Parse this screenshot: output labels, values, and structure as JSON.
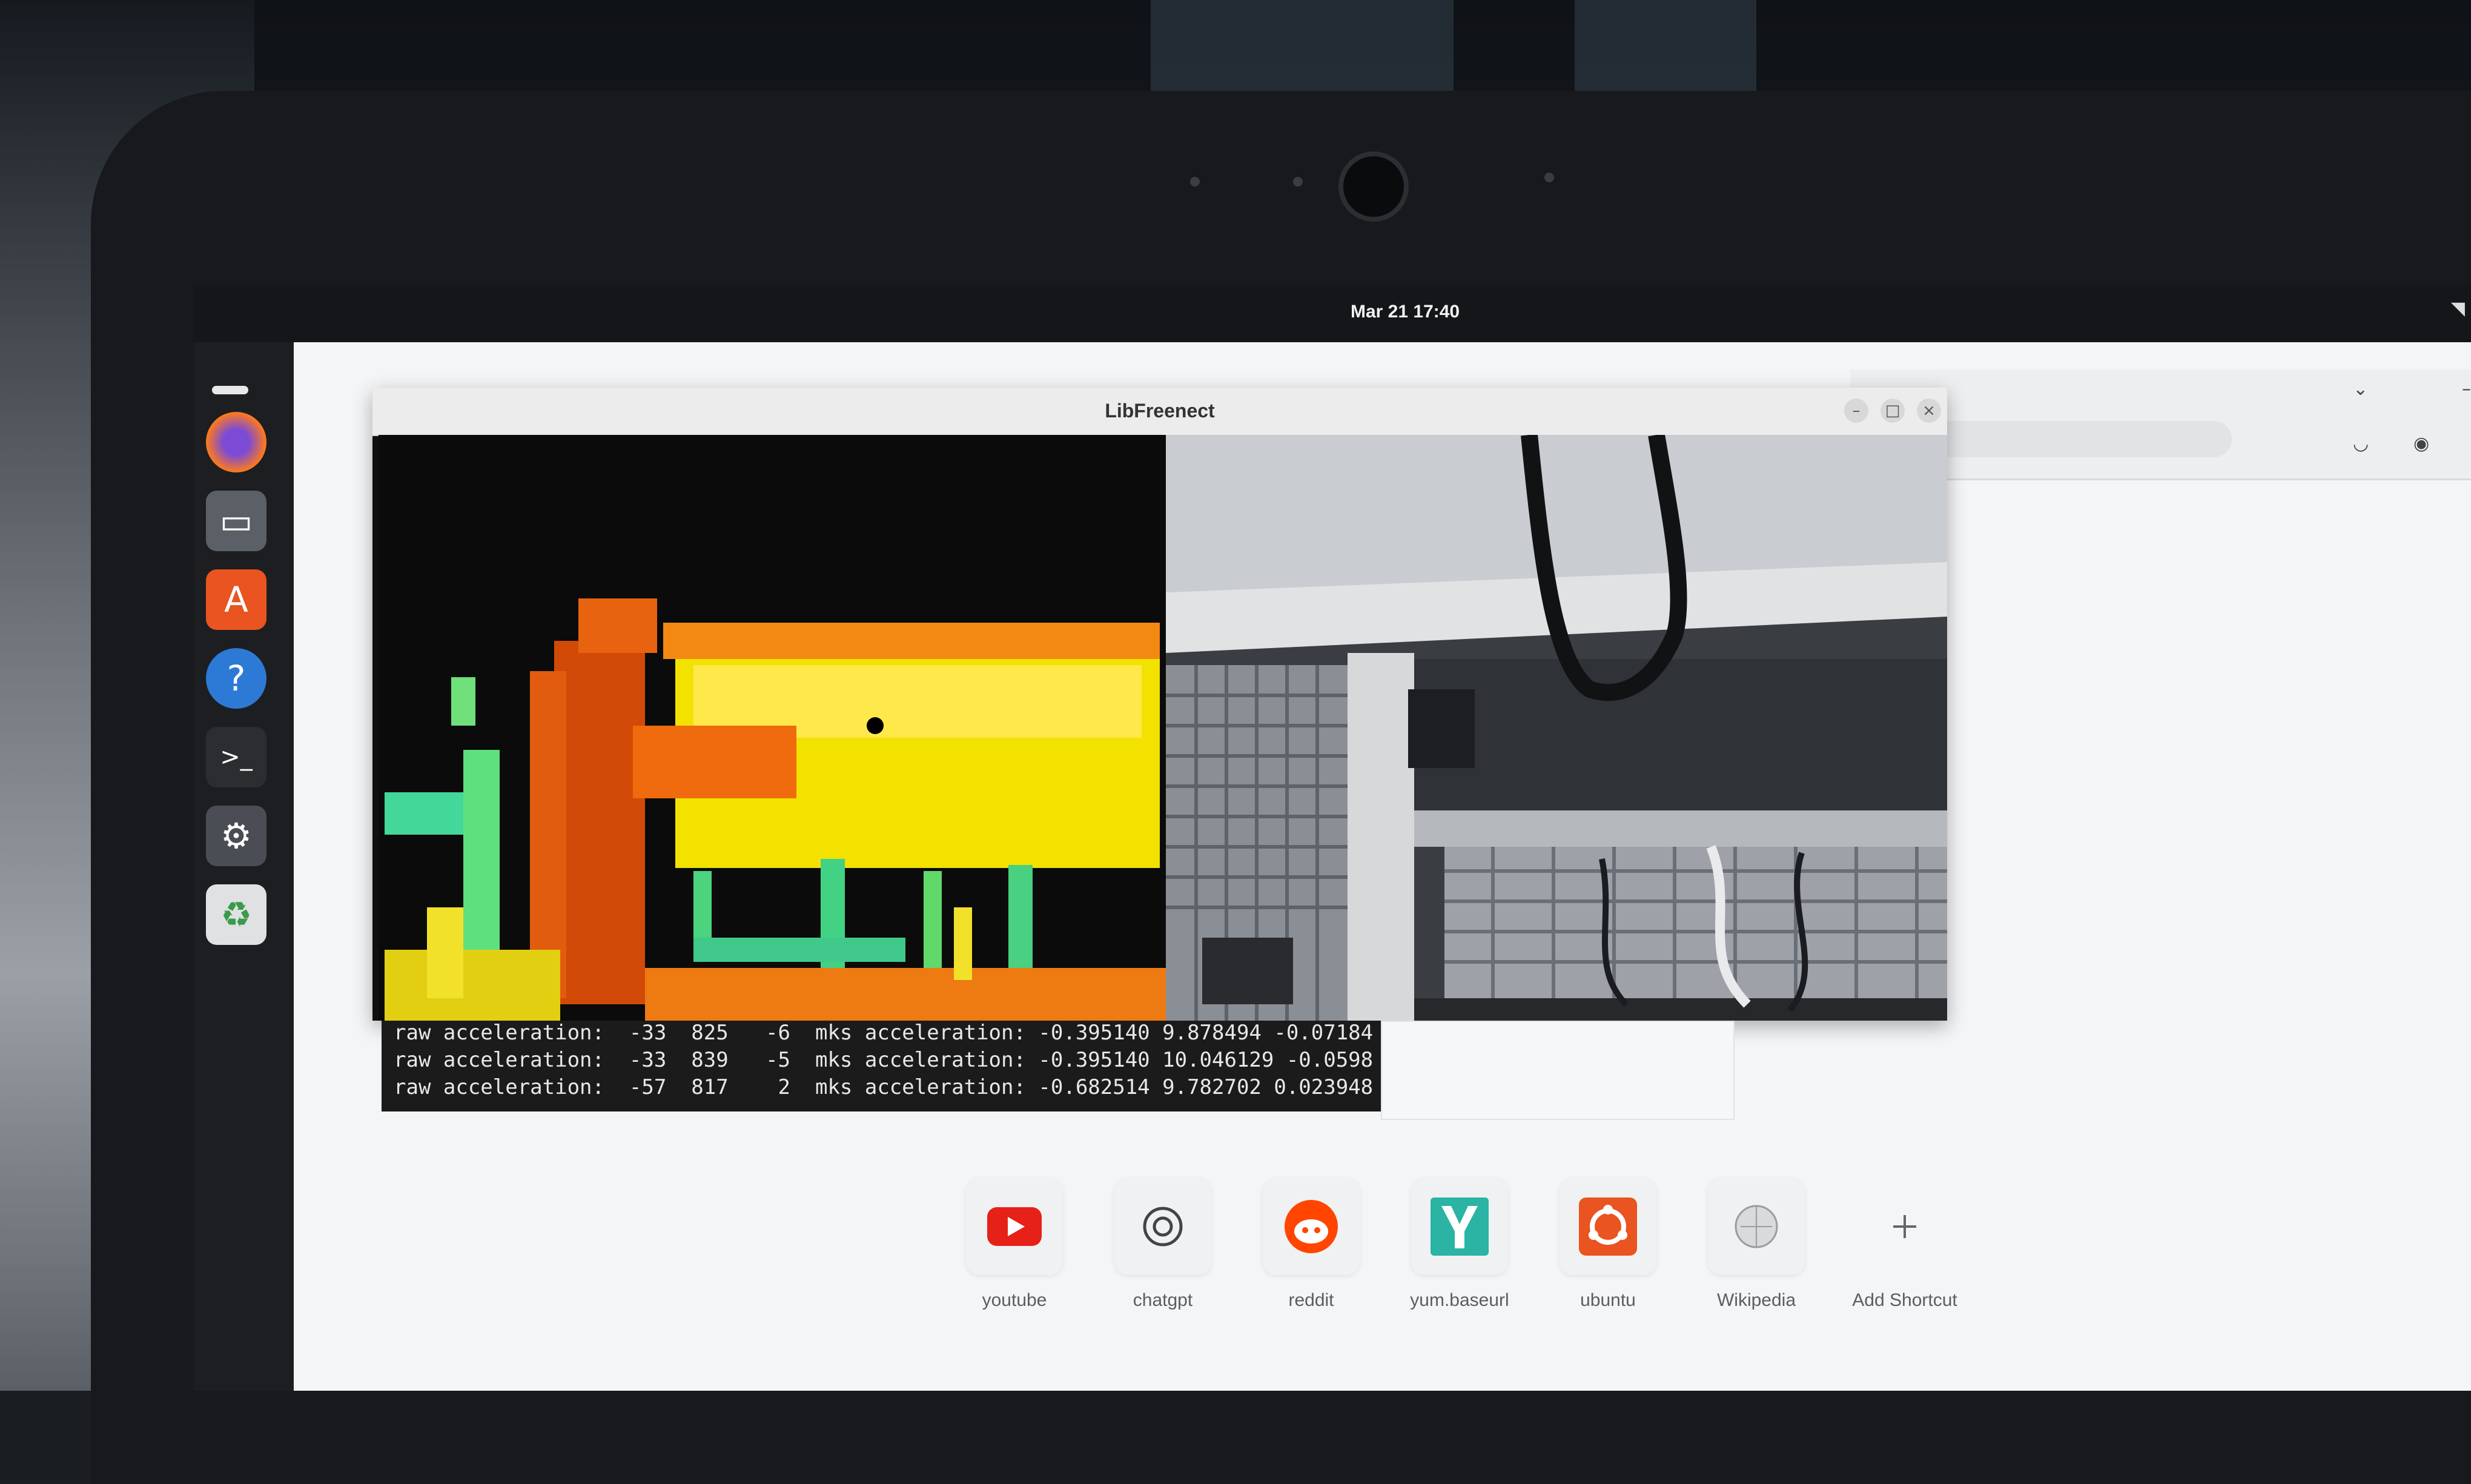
{
  "topbar": {
    "clock": "Mar 21  17:40"
  },
  "window": {
    "title": "LibFreenect"
  },
  "terminal": {
    "lines": [
      "raw acceleration:  -33  825   -6  mks acceleration: -0.395140 9.878494 -0.07184",
      "raw acceleration:  -33  839   -5  mks acceleration: -0.395140 10.046129 -0.0598",
      "raw acceleration:  -57  817    2  mks acceleration: -0.682514 9.782702 0.023948"
    ]
  },
  "shortcuts": [
    {
      "label": "youtube",
      "icon": "youtube-icon"
    },
    {
      "label": "chatgpt",
      "icon": "chatgpt-icon"
    },
    {
      "label": "reddit",
      "icon": "reddit-icon"
    },
    {
      "label": "yum.baseurl",
      "icon": "yum-icon"
    },
    {
      "label": "ubuntu",
      "icon": "ubuntu-icon"
    },
    {
      "label": "Wikipedia",
      "icon": "wikipedia-icon"
    },
    {
      "label": "Add Shortcut",
      "icon": "plus-icon"
    }
  ],
  "dock": [
    {
      "name": "firefox",
      "icon": "firefox-icon"
    },
    {
      "name": "files",
      "icon": "files-icon"
    },
    {
      "name": "app-center",
      "icon": "app-center-icon"
    },
    {
      "name": "help",
      "icon": "help-icon"
    },
    {
      "name": "terminal",
      "icon": "terminal-icon"
    },
    {
      "name": "settings",
      "icon": "gear-icon"
    },
    {
      "name": "trash",
      "icon": "trash-icon"
    }
  ],
  "colors": {
    "depth_near": "#d43c00",
    "depth_mid": "#ffe600",
    "depth_far": "#3ee08a",
    "youtube_red": "#e62117",
    "reddit_orange": "#ff4500",
    "ubuntu_orange": "#e95420",
    "yum_teal": "#2bb3a3"
  }
}
